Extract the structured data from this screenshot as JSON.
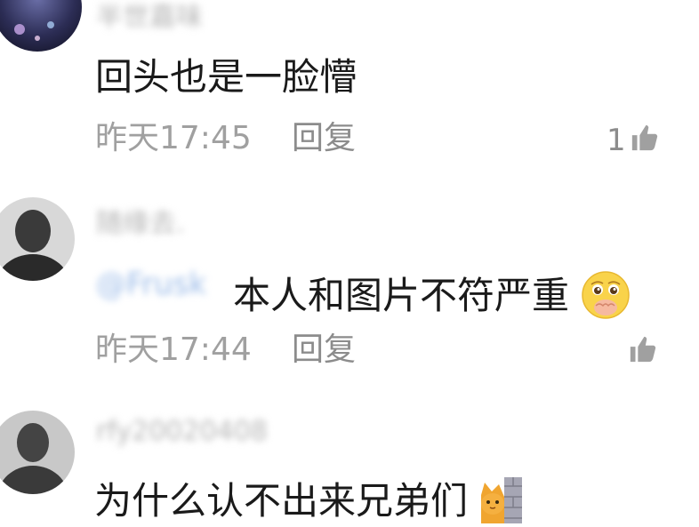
{
  "comments": [
    {
      "username": "半世嘉味",
      "text": "回头也是一脸懵",
      "time": "昨天17:45",
      "reply_label": "回复",
      "like_count": "1",
      "avatar_icon": "avatar-night-photo"
    },
    {
      "username": "随缘去.",
      "mention": "@Frusk",
      "text": "本人和图片不符严重",
      "emoji": "face-with-hand-over-mouth-icon",
      "time": "昨天17:44",
      "reply_label": "回复",
      "like_count": "",
      "avatar_icon": "avatar-man-photo"
    },
    {
      "username": "rfy20020408",
      "text": "为什么认不出来兄弟们",
      "emoji": "cat-peeking-icon",
      "time": "",
      "reply_label": "",
      "like_count": "",
      "avatar_icon": "avatar-man-photo"
    }
  ],
  "colors": {
    "text": "#1a1a1a",
    "meta": "#a0a0a0",
    "mention": "#9bbbe8",
    "background": "#ffffff"
  }
}
